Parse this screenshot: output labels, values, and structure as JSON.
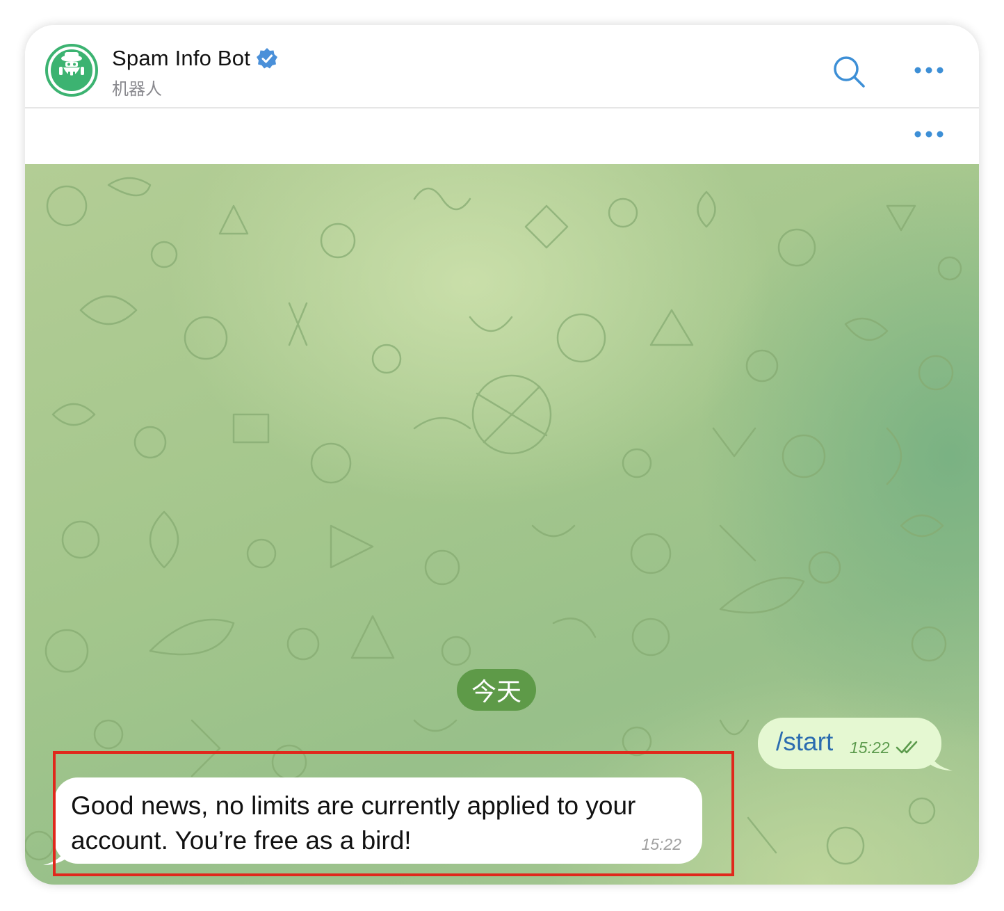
{
  "header": {
    "title": "Spam Info Bot",
    "subtitle": "机器人",
    "verified_icon": "verified-badge-icon",
    "search_icon": "search-icon",
    "more_icon": "more-dots-icon"
  },
  "pinned_bar": {
    "more_icon": "more-dots-icon"
  },
  "chat": {
    "date_label": "今天",
    "messages": [
      {
        "direction": "outgoing",
        "text": "/start",
        "time": "15:22",
        "status_icon": "double-check-icon"
      },
      {
        "direction": "incoming",
        "text": "Good news, no limits are currently applied to your account. You’re free as a bird!",
        "time": "15:22"
      }
    ]
  },
  "colors": {
    "accent": "#4a90d9",
    "bot_avatar_green": "#3cb371",
    "date_pill": "#5e9a48",
    "outgoing_bubble": "#e5f8d2",
    "outgoing_text": "#2b6cb0",
    "highlight_box": "#e0281c"
  }
}
